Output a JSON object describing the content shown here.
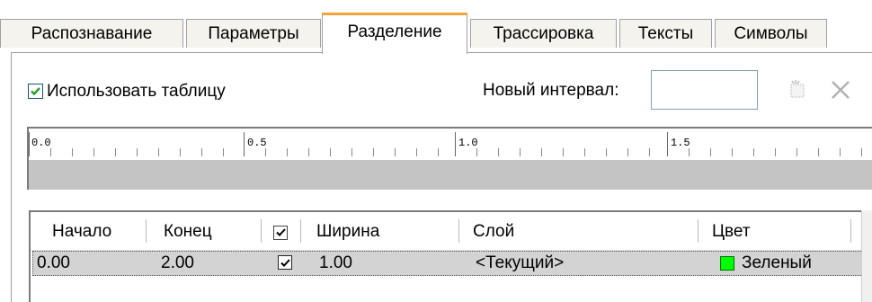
{
  "tabs": [
    {
      "label": "Распознавание",
      "active": false
    },
    {
      "label": "Параметры",
      "active": false
    },
    {
      "label": "Разделение",
      "active": true
    },
    {
      "label": "Трассировка",
      "active": false
    },
    {
      "label": "Тексты",
      "active": false
    },
    {
      "label": "Символы",
      "active": false
    }
  ],
  "options": {
    "use_table_label": "Использовать таблицу",
    "use_table_checked": true,
    "new_interval_label": "Новый интервал:",
    "new_interval_value": ""
  },
  "toolbar": {
    "add_icon": "new-interval-icon",
    "delete_icon": "delete-x-icon"
  },
  "ruler": {
    "labels": [
      "0.0",
      "0.5",
      "1.0",
      "1.5"
    ]
  },
  "table": {
    "columns": [
      "Начало",
      "Конец",
      "☑",
      "Ширина",
      "Слой",
      "Цвет"
    ],
    "rows": [
      {
        "start": "0.00",
        "end": "2.00",
        "checked": true,
        "width": "1.00",
        "layer": "<Текущий>",
        "color": "Зеленый",
        "color_hex": "#00ff00"
      }
    ]
  },
  "colors": {
    "active_tab_accent": "#f0a43a",
    "selected_row": "#d3d3d3",
    "checkbox_check": "#21a121"
  }
}
